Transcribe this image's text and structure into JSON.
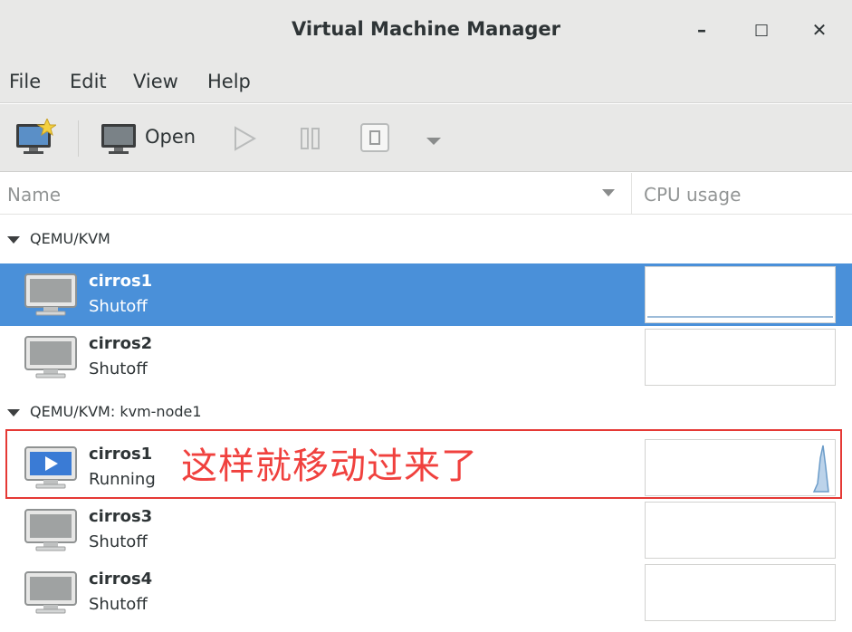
{
  "window": {
    "title": "Virtual Machine Manager",
    "minimize_glyph": "–",
    "maximize_glyph": "□",
    "close_glyph": "✕"
  },
  "menubar": {
    "items": [
      {
        "label": "File"
      },
      {
        "label": "Edit"
      },
      {
        "label": "View"
      },
      {
        "label": "Help"
      }
    ]
  },
  "toolbar": {
    "new_vm_icon": "new-vm-icon",
    "open_label": "Open",
    "run_icon": "play-icon",
    "pause_icon": "pause-icon",
    "shutdown_icon": "shutdown-icon",
    "shutdown_menu_icon": "dropdown-arrow-icon"
  },
  "columns": {
    "name": "Name",
    "cpu_usage": "CPU usage"
  },
  "connections": [
    {
      "label": "QEMU/KVM",
      "vms": [
        {
          "name": "cirros1",
          "state": "Shutoff",
          "selected": true,
          "running": false
        },
        {
          "name": "cirros2",
          "state": "Shutoff",
          "selected": false,
          "running": false
        }
      ]
    },
    {
      "label": "QEMU/KVM: kvm-node1",
      "vms": [
        {
          "name": "cirros1",
          "state": "Running",
          "selected": false,
          "running": true
        },
        {
          "name": "cirros3",
          "state": "Shutoff",
          "selected": false,
          "running": false
        },
        {
          "name": "cirros4",
          "state": "Shutoff",
          "selected": false,
          "running": false
        }
      ]
    }
  ],
  "annotation": {
    "text": "这样就移动过来了",
    "color": "#e53935"
  },
  "colors": {
    "selection": "#4a90d9",
    "chrome": "#e8e8e7"
  }
}
